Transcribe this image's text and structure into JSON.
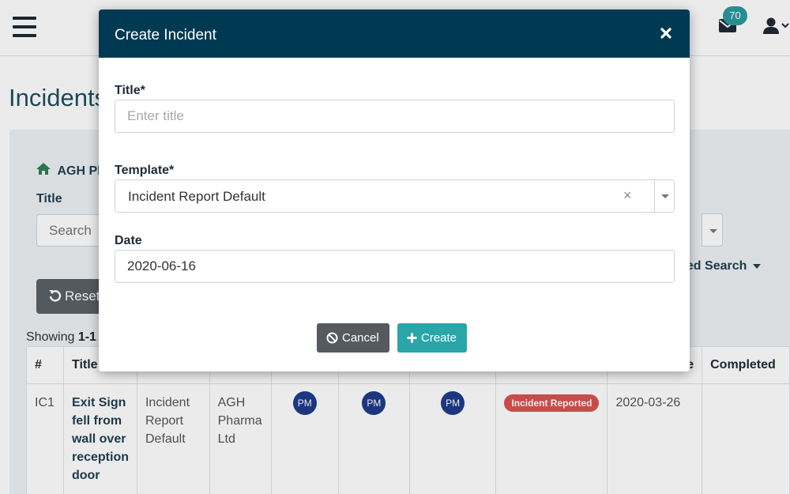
{
  "topbar": {
    "menu_icon": "hamburger-icon",
    "mail_icon": "envelope-icon",
    "notification_count": "70",
    "user_icon": "user-icon"
  },
  "page": {
    "title": "Incidents",
    "company": "AGH Pl",
    "title_filter_label": "Title",
    "search_placeholder": "Search",
    "advanced_search_label": "ced Search",
    "reset_label": "Reset",
    "showing_prefix": "Showing",
    "showing_range": "1-1"
  },
  "table": {
    "headers": [
      "#",
      "Title",
      "",
      "",
      "",
      "",
      "",
      "",
      "e",
      "Completed"
    ],
    "rows": [
      {
        "id": "IC1",
        "title": "Exit Sign fell from wall over reception door",
        "template": "Incident Report Default",
        "company": "AGH Pharma Ltd",
        "assignee1": "PM",
        "assignee2": "PM",
        "assignee3": "PM",
        "status": "Incident Reported",
        "date": "2020-03-26",
        "completed": ""
      }
    ]
  },
  "modal": {
    "title": "Create Incident",
    "close_icon": "close-icon",
    "title_label": "Title*",
    "title_placeholder": "Enter title",
    "title_value": "",
    "template_label": "Template*",
    "template_value": "Incident Report Default",
    "clear_glyph": "×",
    "date_label": "Date",
    "date_value": "2020-06-16",
    "cancel_label": "Cancel",
    "create_label": "Create"
  },
  "colors": {
    "header": "#003a52",
    "accent": "#2aa6a9",
    "cancel": "#555a5f",
    "status": "#d9534f",
    "avatar": "#1f3c8a"
  }
}
